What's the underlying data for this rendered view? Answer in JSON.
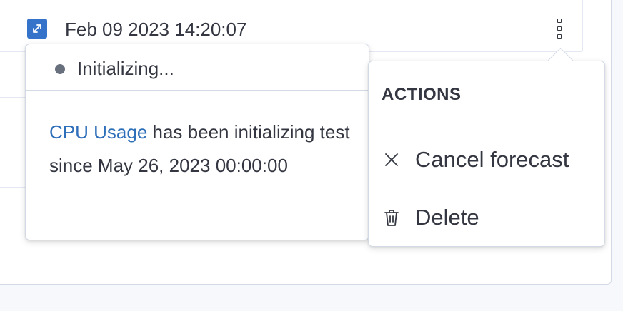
{
  "table": {
    "row_date": "Feb 09 2023 14:20:07"
  },
  "status_popover": {
    "status": "Initializing...",
    "link_text": "CPU Usage",
    "message": " has been initializing test since May 26, 2023 00:00:00"
  },
  "actions_popover": {
    "title": "ACTIONS",
    "items": [
      {
        "label": "Cancel forecast",
        "icon": "close-icon"
      },
      {
        "label": "Delete",
        "icon": "trash-icon"
      }
    ]
  },
  "colors": {
    "accent": "#3473c9",
    "link": "#2e6fb9",
    "status_dot": "#69707d",
    "text": "#343741"
  }
}
